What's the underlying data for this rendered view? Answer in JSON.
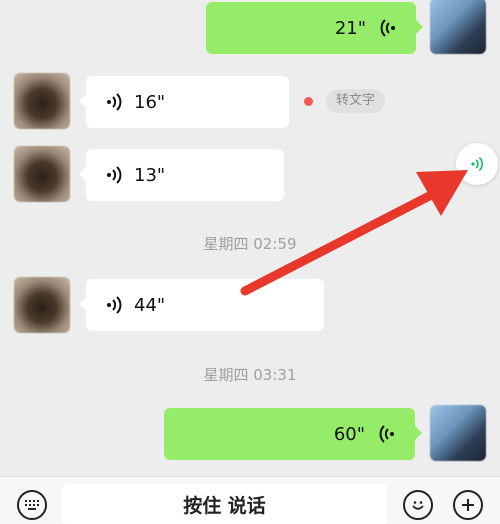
{
  "messages": [
    {
      "side": "self",
      "duration": "21\""
    },
    {
      "side": "other",
      "duration": "16\"",
      "convert_label": "转文字"
    },
    {
      "side": "other",
      "duration": "13\""
    },
    {
      "side": "other",
      "duration": "44\""
    },
    {
      "side": "self",
      "duration": "60\""
    }
  ],
  "timestamps": [
    "星期四 02:59",
    "星期四 03:31"
  ],
  "input_bar": {
    "hold_to_talk_label": "按住 说话",
    "left_icon": "keyboard-icon",
    "right_icons": [
      "emoji-icon",
      "plus-icon"
    ]
  },
  "annotation": {
    "arrow_color": "#e8372b",
    "floating_button_icon": "voice-icon"
  },
  "colors": {
    "self_bubble": "#95ec69",
    "other_bubble": "#ffffff",
    "background": "#ededed",
    "accent_green": "#07c160"
  }
}
